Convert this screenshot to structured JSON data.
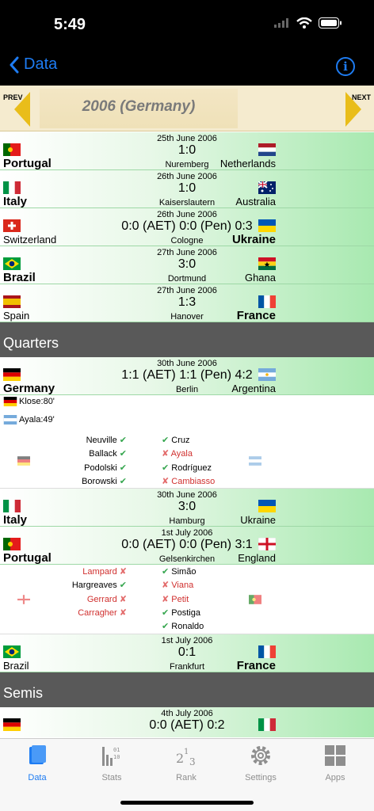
{
  "status": {
    "time": "5:49"
  },
  "nav": {
    "back_label": "Data"
  },
  "selector": {
    "prev": "PREV",
    "next": "NEXT",
    "title": "2006 (Germany)"
  },
  "colors": {
    "accent": "#1e7cf2",
    "gold": "#e9bd1a",
    "stage_bg": "#595959",
    "red": "#d0302f",
    "green": "#36a64f"
  },
  "r16": [
    {
      "date": "25th June 2006",
      "score": "1:0",
      "venue": "Nuremberg",
      "left": "Portugal",
      "right": "Netherlands",
      "winner": "left"
    },
    {
      "date": "26th June 2006",
      "score": "1:0",
      "venue": "Kaiserslautern",
      "left": "Italy",
      "right": "Australia",
      "winner": "left"
    },
    {
      "date": "26th June 2006",
      "score": "0:0  (AET) 0:0  (Pen) 0:3",
      "venue": "Cologne",
      "left": "Switzerland",
      "right": "Ukraine",
      "winner": "right"
    },
    {
      "date": "27th June 2006",
      "score": "3:0",
      "venue": "Dortmund",
      "left": "Brazil",
      "right": "Ghana",
      "winner": "left"
    },
    {
      "date": "27th June 2006",
      "score": "1:3",
      "venue": "Hanover",
      "left": "Spain",
      "right": "France",
      "winner": "right"
    }
  ],
  "quarters": {
    "label": "Quarters",
    "m1": {
      "date": "30th June 2006",
      "score": "1:1  (AET) 1:1  (Pen) 4:2",
      "venue": "Berlin",
      "left": "Germany",
      "right": "Argentina"
    },
    "m1_scorers": [
      "Klose:80'",
      "Ayala:49'"
    ],
    "m1_pens_left": [
      "Neuville",
      "Ballack",
      "Podolski",
      "Borowski"
    ],
    "m1_pens_right": [
      "Cruz",
      "Ayala",
      "Rodríguez",
      "Cambiasso"
    ],
    "m2": {
      "date": "30th June 2006",
      "score": "3:0",
      "venue": "Hamburg",
      "left": "Italy",
      "right": "Ukraine"
    },
    "m3": {
      "date": "1st July 2006",
      "score": "0:0  (AET) 0:0  (Pen) 3:1",
      "venue": "Gelsenkirchen",
      "left": "Portugal",
      "right": "England"
    },
    "m3_pens_left": [
      "Lampard",
      "Hargreaves",
      "Gerrard",
      "Carragher"
    ],
    "m3_pens_right": [
      "Simão",
      "Viana",
      "Petit",
      "Postiga",
      "Ronaldo"
    ],
    "m4": {
      "date": "1st July 2006",
      "score": "0:1",
      "venue": "Frankfurt",
      "left": "Brazil",
      "right": "France"
    }
  },
  "semis": {
    "label": "Semis",
    "m1": {
      "date": "4th July 2006",
      "score": "0:0  (AET) 0:2"
    }
  },
  "tabs": {
    "data": "Data",
    "stats": "Stats",
    "rank": "Rank",
    "settings": "Settings",
    "apps": "Apps"
  },
  "icons": {
    "back": "chevron-left-icon",
    "info": "info-icon"
  }
}
